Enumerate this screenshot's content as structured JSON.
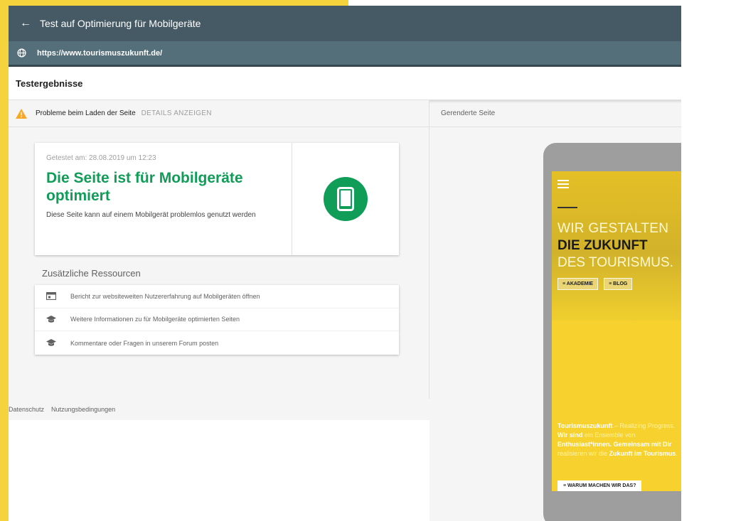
{
  "app": {
    "title": "Test auf Optimierung für Mobilgeräte",
    "back_icon": "arrow-left-icon",
    "url": "https://www.tourismuszukunft.de/"
  },
  "results": {
    "title": "Testergebnisse"
  },
  "warning": {
    "text": "Probleme beim Laden der Seite",
    "details_label": "DETAILS ANZEIGEN",
    "color": "#f9a825"
  },
  "result_card": {
    "tested_on": "Getestet am: 28.08.2019 um 12:23",
    "headline": "Die Seite ist für Mobilgeräte optimiert",
    "description": "Diese Seite kann auf einem Mobilgerät problemlos genutzt werden",
    "accent": "#0f9d58",
    "icon": "smartphone-icon"
  },
  "resources": {
    "heading": "Zusätzliche Ressourcen",
    "items": [
      {
        "label": "Bericht zur websiteweiten Nutzererfahrung auf Mobilgeräten öffnen",
        "icon": "web-report-icon"
      },
      {
        "label": "Weitere Informationen zu für Mobilgeräte optimierten Seiten",
        "icon": "graduation-cap-icon"
      },
      {
        "label": "Kommentare oder Fragen in unserem Forum posten",
        "icon": "graduation-cap-icon"
      }
    ]
  },
  "footer": {
    "privacy": "Datenschutz",
    "terms": "Nutzungsbedingungen"
  },
  "rendered": {
    "label": "Gerenderte Seite",
    "hero_line1": "WIR GESTALTEN",
    "hero_line2": "DIE ZUKUNFT",
    "hero_line3": "DES TOURISMUS.",
    "btn_academy": "≡ AKADEMIE",
    "btn_blog": "≡ BLOG",
    "text_brand": "Tourismuszukunft",
    "text_tagline": " – Realizing Progress.",
    "text_wir": "Wir sind",
    "text_ensemble": " ein Ensemble von",
    "text_enth": "Enthusiast*innen. Gemeinsam mit Dir",
    "text_realisieren": "realisieren wir die ",
    "text_zukunft": "Zukunft im Tourismus",
    "text_end": ".",
    "cta": "≡ WARUM MACHEN WIR DAS?"
  }
}
